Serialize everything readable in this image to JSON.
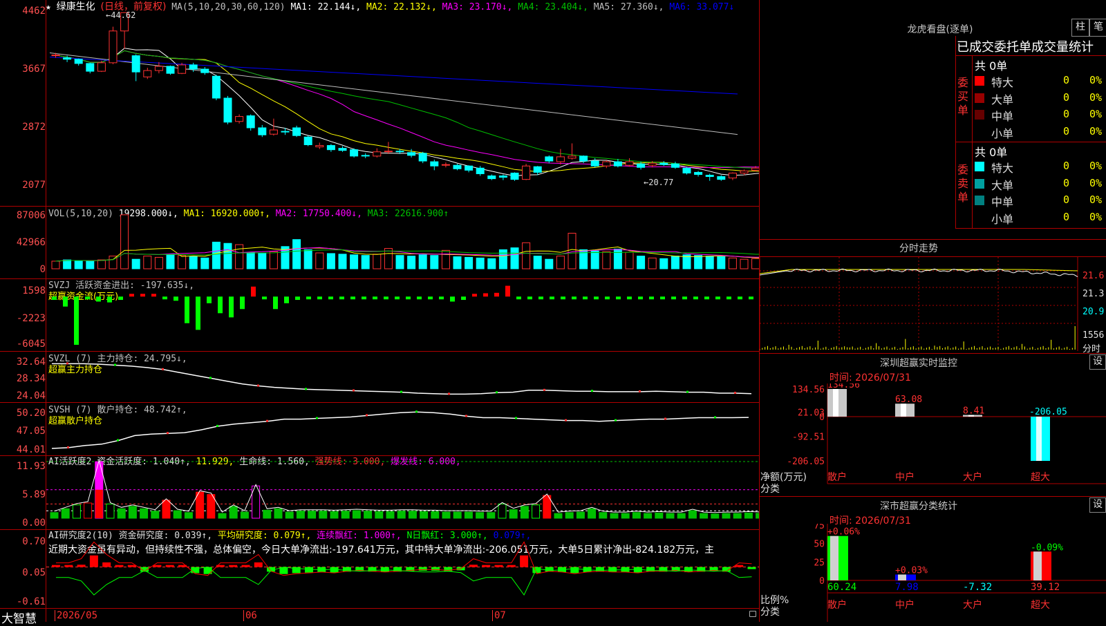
{
  "main_panel": {
    "stock_name": "绿康生化",
    "period": "(日线，前复权)",
    "ma_label": "MA(5,10,20,30,60,120)",
    "ma1": "MA1: 22.144↓,",
    "ma2": "MA2: 22.132↓,",
    "ma3": "MA3: 23.170↓,",
    "ma4": "MA4: 23.404↓,",
    "ma5": "MA5: 27.360↓,",
    "ma6": "MA6: 33.077↓",
    "y_ticks": [
      "4462",
      "3667",
      "2872",
      "2077"
    ],
    "high_label": "44.62",
    "low_label": "20.77"
  },
  "vol_panel": {
    "label": "VOL(5,10,20)",
    "value": "19298.000↓,",
    "ma1": "MA1: 16920.000↑,",
    "ma2": "MA2: 17750.400↓,",
    "ma3": "MA3: 22616.900↑",
    "y_ticks": [
      "87006",
      "42966",
      "0"
    ]
  },
  "svzj_panel": {
    "label": "SVZJ  活跃资金进出: -197.635↓,",
    "sub": "超赢资金流(万元)",
    "y_ticks": [
      "1598",
      "-2223",
      "-6045"
    ]
  },
  "svzl_panel": {
    "label": "SVZL (7) 主力持仓: 24.795↓,",
    "sub": "超赢主力持仓",
    "y_ticks": [
      "32.64",
      "28.34",
      "24.04"
    ]
  },
  "svsh_panel": {
    "label": "SVSH (7) 散户持仓: 48.742↑,",
    "sub": "超赢散户持仓",
    "y_ticks": [
      "50.20",
      "47.05",
      "44.01"
    ]
  },
  "ai1_panel": {
    "label": "AI活跃度2 资金活跃度: 1.040↑,",
    "v2": "11.929,",
    "v3": "生命线: 1.560,",
    "v4": "强势线: 3.000,",
    "v5": "爆发线: 6.000,",
    "y_ticks": [
      "11.93",
      "5.89",
      "0.00"
    ]
  },
  "ai2_panel": {
    "label": "AI研究度2(10) 资金研究度: 0.039↑,",
    "v2": "平均研究度: 0.079↑,",
    "v3": "连续飘红: 1.000↑,",
    "v4": "N日飘红: 3.000↑,",
    "v5": "0.079↑,",
    "comment": "近期大资金虽有异动，但持续性不强，总体偏空，今日大单净流出:-197.641万元，其中特大单净流出:-206.051万元，大单5日累计净出-824.182万元，主",
    "y_ticks": [
      "0.70",
      "0.05",
      "-0.61"
    ]
  },
  "date_axis": {
    "brand": "大智慧",
    "labels": [
      "2026/05",
      "06",
      "07"
    ]
  },
  "longhu": {
    "title": "龙虎看盘(逐单)",
    "btn_bar": "柱",
    "btn_line": "笔",
    "section_title": "已成交委托单成交量统计",
    "buy_label": "委买单",
    "sell_label": "委卖单",
    "buy_total": "共 0单",
    "sell_total": "共 0单",
    "buy_rows": [
      {
        "name": "特大",
        "count": "0",
        "pct": "0%",
        "color": "#ff0000"
      },
      {
        "name": "大单",
        "count": "0",
        "pct": "0%",
        "color": "#990000"
      },
      {
        "name": "中单",
        "count": "0",
        "pct": "0%",
        "color": "#660000"
      },
      {
        "name": "小单",
        "count": "0",
        "pct": "0%",
        "color": "#000000"
      }
    ],
    "sell_rows": [
      {
        "name": "特大",
        "count": "0",
        "pct": "0%",
        "color": "#00ffff"
      },
      {
        "name": "大单",
        "count": "0",
        "pct": "0%",
        "color": "#00a0a0"
      },
      {
        "name": "中单",
        "count": "0",
        "pct": "0%",
        "color": "#008080"
      },
      {
        "name": "小单",
        "count": "0",
        "pct": "0%",
        "color": "#000000"
      }
    ]
  },
  "intraday": {
    "title": "分时走势",
    "right_ticks": [
      "21.6",
      "21.3",
      "20.9",
      "1556",
      "分时"
    ]
  },
  "sz_monitor": {
    "title": "深圳超赢实时监控",
    "btn": "设",
    "time": "时间: 2026/07/31",
    "y_ticks": [
      "134.56",
      "21.03",
      "0",
      "-92.51",
      "-206.05"
    ],
    "axis_title": "净额(万元)",
    "axis_sub": "分类",
    "categories": [
      "散户",
      "中户",
      "大户",
      "超大"
    ],
    "values": [
      134.56,
      63.08,
      8.41,
      -206.05
    ],
    "value_labels": [
      "134.56",
      "63.08",
      "8.41",
      "-206.05"
    ]
  },
  "sz_class": {
    "title": "深市超赢分类统计",
    "btn": "设",
    "time": "时间: 2026/07/31",
    "y_ticks": [
      "75",
      "50",
      "25",
      "0"
    ],
    "axis_title": "比例%",
    "axis_sub": "分类",
    "categories": [
      "散户",
      "中户",
      "大户",
      "超大"
    ],
    "pct_labels": [
      "+0.06%",
      "+0.03%",
      "",
      "-0.09%"
    ],
    "bottom_values": [
      "60.24",
      "7.98",
      "-7.32",
      "39.12"
    ],
    "heights": [
      60.24,
      7.98,
      0,
      39.12
    ]
  },
  "colors": {
    "up": "#ff3232",
    "down": "#00ffff",
    "grid": "#b00000",
    "ma1": "#ffffff",
    "ma2": "#ffff00",
    "ma3": "#ff00ff",
    "ma4": "#00c000",
    "ma5": "#c0c0c0",
    "ma6": "#0000ff"
  },
  "chart_data": [
    {
      "type": "candlestick",
      "title": "绿康生化(日线，前复权)",
      "ylim": [
        20.77,
        44.62
      ],
      "candles": [
        [
          38.5,
          38.6,
          38.2,
          38.9
        ],
        [
          38.2,
          38.0,
          37.6,
          38.5
        ],
        [
          38.0,
          37.4,
          37.1,
          38.1
        ],
        [
          37.4,
          36.3,
          36.0,
          37.5
        ],
        [
          36.3,
          37.5,
          36.2,
          37.8
        ],
        [
          37.5,
          42.0,
          37.3,
          42.6
        ],
        [
          42.0,
          44.6,
          39.5,
          44.6
        ],
        [
          38.5,
          36.2,
          34.9,
          38.7
        ],
        [
          35.5,
          36.4,
          35.2,
          36.8
        ],
        [
          36.4,
          37.0,
          36.0,
          37.6
        ],
        [
          37.0,
          36.0,
          35.8,
          37.1
        ],
        [
          36.0,
          37.2,
          35.9,
          37.5
        ],
        [
          37.2,
          36.6,
          36.2,
          37.5
        ],
        [
          36.6,
          36.1,
          35.8,
          36.9
        ],
        [
          35.6,
          32.5,
          32.2,
          35.8
        ],
        [
          32.5,
          29.1,
          28.8,
          32.8
        ],
        [
          29.2,
          29.9,
          28.9,
          30.2
        ],
        [
          30.0,
          28.3,
          27.9,
          30.2
        ],
        [
          28.3,
          27.3,
          27.0,
          28.7
        ],
        [
          27.4,
          28.0,
          27.2,
          29.6
        ],
        [
          27.8,
          27.7,
          27.3,
          28.3
        ],
        [
          28.3,
          27.2,
          27.0,
          28.6
        ],
        [
          27.0,
          25.9,
          25.7,
          27.2
        ],
        [
          25.6,
          25.8,
          25.3,
          26.2
        ],
        [
          25.8,
          25.2,
          24.9,
          26.0
        ],
        [
          25.4,
          25.1,
          24.9,
          25.7
        ],
        [
          25.2,
          24.3,
          24.1,
          25.4
        ],
        [
          24.4,
          24.3,
          24.0,
          24.7
        ],
        [
          24.3,
          24.9,
          24.1,
          25.4
        ],
        [
          25.0,
          25.0,
          24.6,
          26.3
        ],
        [
          25.0,
          24.9,
          24.6,
          25.3
        ],
        [
          24.8,
          24.4,
          24.1,
          25.3
        ],
        [
          24.7,
          23.6,
          23.3,
          24.9
        ],
        [
          23.5,
          22.9,
          22.3,
          23.8
        ],
        [
          23.0,
          23.1,
          22.7,
          23.4
        ],
        [
          23.0,
          22.5,
          22.3,
          23.2
        ],
        [
          22.9,
          22.3,
          22.0,
          23.0
        ],
        [
          22.6,
          21.8,
          21.5,
          22.9
        ],
        [
          21.5,
          21.1,
          20.9,
          21.7
        ],
        [
          21.5,
          21.3,
          20.9,
          21.7
        ],
        [
          21.9,
          21.0,
          20.8,
          22.0
        ],
        [
          21.0,
          22.9,
          20.9,
          23.2
        ],
        [
          22.8,
          22.0,
          21.6,
          22.9
        ],
        [
          24.2,
          23.6,
          23.3,
          24.4
        ],
        [
          23.5,
          24.2,
          23.1,
          25.3
        ],
        [
          24.0,
          24.3,
          23.8,
          26.1
        ],
        [
          24.3,
          23.6,
          23.3,
          24.4
        ],
        [
          23.6,
          22.9,
          22.7,
          24.0
        ],
        [
          22.9,
          23.5,
          22.6,
          23.7
        ],
        [
          23.5,
          22.9,
          22.7,
          23.9
        ],
        [
          23.0,
          23.5,
          22.8,
          24.0
        ],
        [
          23.2,
          22.7,
          22.4,
          23.5
        ],
        [
          23.0,
          23.3,
          22.7,
          23.6
        ],
        [
          23.3,
          23.1,
          22.9,
          23.6
        ],
        [
          23.2,
          22.7,
          22.5,
          23.5
        ],
        [
          22.6,
          21.9,
          21.7,
          22.8
        ],
        [
          22.0,
          21.7,
          21.4,
          22.2
        ],
        [
          21.6,
          21.4,
          20.8,
          21.8
        ],
        [
          21.4,
          21.0,
          20.8,
          21.6
        ],
        [
          21.2,
          21.9,
          20.9,
          22.0
        ],
        [
          21.9,
          22.2,
          21.6,
          22.4
        ],
        [
          22.3,
          22.6,
          22.1,
          22.9
        ],
        [
          22.7,
          22.1,
          21.9,
          22.9
        ],
        [
          22.2,
          21.9,
          21.7,
          22.4
        ],
        [
          21.8,
          21.9,
          21.5,
          22.0
        ],
        [
          22.0,
          21.0,
          20.9,
          22.1
        ],
        [
          21.0,
          20.9,
          20.8,
          21.4
        ]
      ]
    },
    {
      "type": "bar",
      "title": "VOL(5,10,20)",
      "ylim": [
        0,
        87006
      ],
      "values": [
        12000,
        14000,
        13000,
        12500,
        14000,
        20000,
        85000,
        15000,
        20000,
        18000,
        23000,
        21000,
        19000,
        17000,
        42000,
        40000,
        38000,
        26000,
        25000,
        27000,
        35000,
        46000,
        30000,
        25000,
        24000,
        23000,
        22000,
        21000,
        23000,
        32000,
        21000,
        20000,
        22000,
        21000,
        29000,
        19000,
        18000,
        17000,
        16000,
        30000,
        33000,
        41000,
        20000,
        15000,
        20000,
        56000,
        30000,
        28000,
        27000,
        31000,
        26000,
        20000,
        17000,
        16000,
        20000,
        22000,
        21000,
        20000,
        19000,
        17000,
        15000,
        16000,
        17000,
        16000,
        19000,
        19298,
        15000
      ]
    },
    {
      "type": "bar",
      "title": "SVZJ 活跃资金进出",
      "ylim": [
        -6045,
        1598
      ],
      "values": [
        -400,
        -1200,
        -5800,
        -300,
        -600,
        -700,
        -400,
        200,
        200,
        150,
        -200,
        -500,
        -3200,
        -4000,
        -800,
        -2000,
        -2500,
        -1500,
        1200,
        -300,
        -1500,
        -800,
        -400,
        -300,
        -300,
        -250,
        -200,
        -200,
        -250,
        -200,
        -200,
        -150,
        -200,
        -200,
        -150,
        -200,
        -600,
        -400,
        300,
        400,
        450,
        1300,
        -200,
        -150,
        -200,
        -200,
        -150,
        -150,
        -200,
        -200,
        -150,
        -150,
        -300,
        -200,
        -150,
        -200,
        -150,
        -100,
        -200,
        -150,
        -150,
        -150,
        -200,
        -197.6
      ]
    },
    {
      "type": "line",
      "title": "SVZL (7) 主力持仓",
      "ylim": [
        24.04,
        32.64
      ],
      "values": [
        31.0,
        31.0,
        31.0,
        30.9,
        30.7,
        30.5,
        30.2,
        29.8,
        29.2,
        28.6,
        28.0,
        27.4,
        26.8,
        26.4,
        26.1,
        25.9,
        25.7,
        25.6,
        25.5,
        25.4,
        25.3,
        25.2,
        25.1,
        24.9,
        24.8,
        24.7,
        24.7,
        24.8,
        25.0,
        25.1,
        25.5,
        25.5,
        25.4,
        25.3,
        25.3,
        25.2,
        25.2,
        25.2,
        25.3,
        25.2,
        25.1,
        25.1,
        24.9,
        24.9,
        24.8
      ]
    },
    {
      "type": "line",
      "title": "SVSH (7) 散户持仓",
      "ylim": [
        44.01,
        50.2
      ],
      "values": [
        44.4,
        44.5,
        44.8,
        45.0,
        45.5,
        46.2,
        46.4,
        46.5,
        46.6,
        47.0,
        47.5,
        47.8,
        48.0,
        48.2,
        48.5,
        48.5,
        48.6,
        48.7,
        48.8,
        49.0,
        49.2,
        49.4,
        49.5,
        49.4,
        49.2,
        48.9,
        48.7,
        48.7,
        48.6,
        48.5,
        48.4,
        48.3,
        48.3,
        48.2,
        48.3,
        48.4,
        48.5,
        48.5,
        48.6,
        48.7,
        48.7,
        48.7,
        48.74
      ]
    },
    {
      "type": "bar",
      "title": "AI活跃度2 资金活跃度",
      "ylim": [
        0,
        11.93
      ],
      "values": [
        1.2,
        2.0,
        2.8,
        3.2,
        11.9,
        3.0,
        2.0,
        2.5,
        2.0,
        1.5,
        3.8,
        1.6,
        1.2,
        5.5,
        5.0,
        1.0,
        2.5,
        1.3,
        6.8,
        1.7,
        2.0,
        1.3,
        1.5,
        1.5,
        1.5,
        1.4,
        1.5,
        1.6,
        1.5,
        1.4,
        1.4,
        1.5,
        1.5,
        1.4,
        1.4,
        1.3,
        1.3,
        1.3,
        1.2,
        1.2,
        3.0,
        1.8,
        2.5,
        2.8,
        4.8,
        1.0,
        1.2,
        1.3,
        2.0,
        1.2,
        1.0,
        1.0,
        1.2,
        1.0,
        1.1,
        1.0,
        1.0,
        1.6,
        1.0,
        0.9,
        1.0,
        1.0,
        1.1,
        1.04
      ]
    },
    {
      "type": "bar",
      "title": "AI研究度2(10) 资金研究度",
      "ylim": [
        -0.61,
        0.7
      ],
      "values": [
        0.05,
        0.05,
        0.1,
        0.3,
        0.15,
        0.05,
        0.05,
        -0.05,
        0.05,
        0.05,
        0.05,
        -0.08,
        -0.1,
        0.05,
        0.05,
        0.05,
        0.15,
        -0.05,
        -0.1,
        -0.08,
        -0.07,
        -0.06,
        -0.07,
        -0.05,
        -0.04,
        -0.05,
        -0.06,
        -0.05,
        -0.04,
        -0.03,
        -0.03,
        -0.04,
        -0.02,
        0.1,
        0.05,
        0.05,
        0.05,
        0.3,
        -0.08,
        -0.05,
        -0.06,
        -0.08,
        -0.06,
        -0.05,
        -0.06,
        -0.06,
        -0.07,
        -0.05,
        -0.05,
        -0.04,
        -0.06,
        -0.05,
        -0.04,
        -0.05,
        0.05,
        0.039
      ]
    }
  ]
}
